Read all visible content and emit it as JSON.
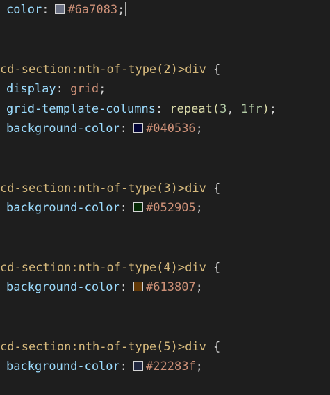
{
  "editor": {
    "line0": {
      "property": "color",
      "colon": ":",
      "value": "#6a7083",
      "semicolon": ";",
      "swatch_color": "#6a7083"
    },
    "rule2": {
      "selector": "cd-section:nth-of-type(2)>div",
      "brace_open": " {",
      "decl1": {
        "property": "display",
        "colon": ":",
        "value": " grid",
        "semicolon": ";"
      },
      "decl2": {
        "property": "grid-template-columns",
        "colon": ":",
        "func": " repeat(",
        "arg1": "3",
        "sep": ", ",
        "arg2": "1fr",
        "close": ")",
        "semicolon": ";"
      },
      "decl3": {
        "property": "background-color",
        "colon": ":",
        "value": "#040536",
        "semicolon": ";",
        "swatch_color": "#040536"
      }
    },
    "rule3": {
      "selector": "cd-section:nth-of-type(3)>div",
      "brace_open": " {",
      "decl1": {
        "property": "background-color",
        "colon": ":",
        "value": "#052905",
        "semicolon": ";",
        "swatch_color": "#052905"
      }
    },
    "rule4": {
      "selector": "cd-section:nth-of-type(4)>div",
      "brace_open": " {",
      "decl1": {
        "property": "background-color",
        "colon": ":",
        "value": "#613807",
        "semicolon": ";",
        "swatch_color": "#613807"
      }
    },
    "rule5": {
      "selector": "cd-section:nth-of-type(5)>div",
      "brace_open": " {",
      "decl1": {
        "property": "background-color",
        "colon": ":",
        "value": "#22283f",
        "semicolon": ";",
        "swatch_color": "#22283f"
      }
    }
  }
}
